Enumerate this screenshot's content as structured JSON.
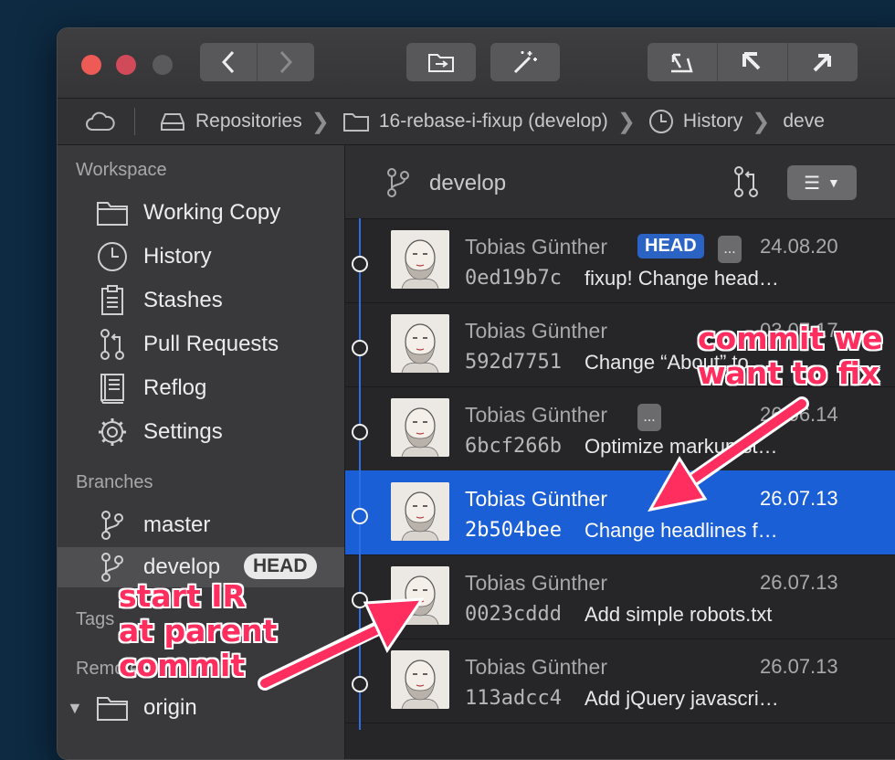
{
  "breadcrumb": {
    "items": [
      "Repositories",
      "16-rebase-i-fixup (develop)",
      "History",
      "deve"
    ]
  },
  "sidebar": {
    "workspace_title": "Workspace",
    "workspace_items": [
      {
        "label": "Working Copy",
        "icon": "folder-icon"
      },
      {
        "label": "History",
        "icon": "clock-icon"
      },
      {
        "label": "Stashes",
        "icon": "clipboard-icon"
      },
      {
        "label": "Pull Requests",
        "icon": "pull-request-icon"
      },
      {
        "label": "Reflog",
        "icon": "book-icon"
      },
      {
        "label": "Settings",
        "icon": "gear-icon"
      }
    ],
    "branches_title": "Branches",
    "branches": [
      {
        "label": "master"
      },
      {
        "label": "develop",
        "badge": "HEAD"
      }
    ],
    "tags_title": "Tags",
    "remotes_title": "Remotes",
    "remotes": [
      {
        "label": "origin"
      }
    ]
  },
  "main": {
    "branch": "develop",
    "commits": [
      {
        "author": "Tobias Günther",
        "date": "24.08.20",
        "hash": "0ed19b7c",
        "message": "fixup! Change head…",
        "badge": "HEAD",
        "more": "..."
      },
      {
        "author": "Tobias Günther",
        "date": "03.07.17",
        "hash": "592d7751",
        "message": "Change “About” to…"
      },
      {
        "author": "Tobias Günther",
        "date": "26.06.14",
        "hash": "6bcf266b",
        "message": "Optimize markup st…",
        "more": "..."
      },
      {
        "author": "Tobias Günther",
        "date": "26.07.13",
        "hash": "2b504bee",
        "message": "Change headlines f…",
        "selected": true
      },
      {
        "author": "Tobias Günther",
        "date": "26.07.13",
        "hash": "0023cddd",
        "message": "Add simple robots.txt"
      },
      {
        "author": "Tobias Günther",
        "date": "26.07.13",
        "hash": "113adcc4",
        "message": "Add jQuery javascri…"
      }
    ]
  },
  "annotations": {
    "right_line1": "commit we",
    "right_line2": "want to fix",
    "left_line1": "start IR",
    "left_line2": "at parent",
    "left_line3": "commit"
  },
  "colors": {
    "accent": "#1b5fd6",
    "annotation": "#ff2e5f"
  }
}
